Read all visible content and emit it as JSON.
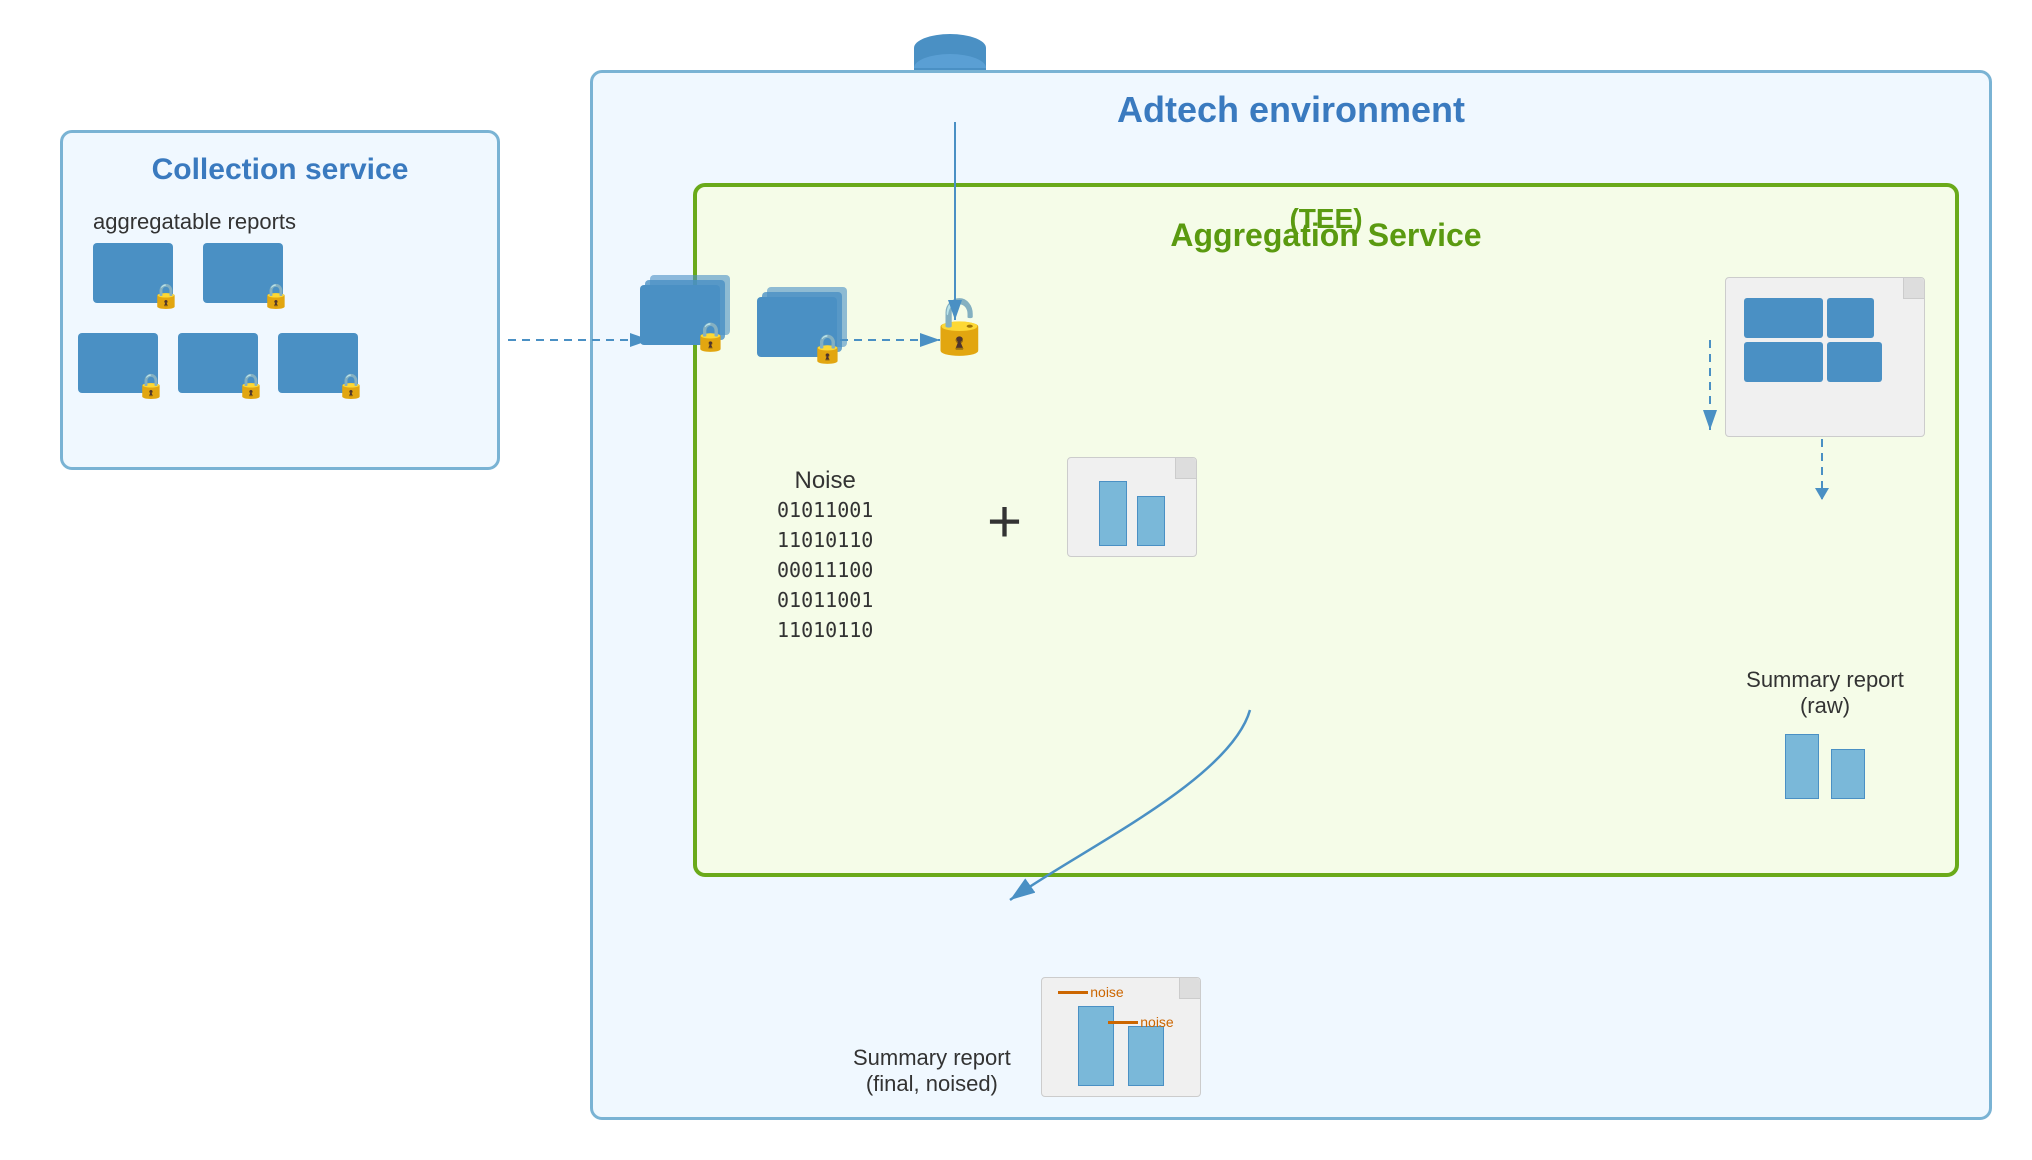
{
  "adtech": {
    "label": "Adtech environment"
  },
  "collection": {
    "title": "Collection service",
    "reports_label": "aggregatable reports"
  },
  "aggregation": {
    "title": "Aggregation Service",
    "subtitle": "(TEE)"
  },
  "noise": {
    "label": "Noise",
    "binary": [
      "01011001",
      "11010110",
      "00011100",
      "01011001",
      "11010110"
    ]
  },
  "summary_raw": {
    "label": "Summary report",
    "sublabel": "(raw)"
  },
  "summary_final": {
    "label": "Summary report",
    "sublabel": "(final, noised)"
  },
  "noise_annotations": [
    "noise",
    "noise"
  ]
}
